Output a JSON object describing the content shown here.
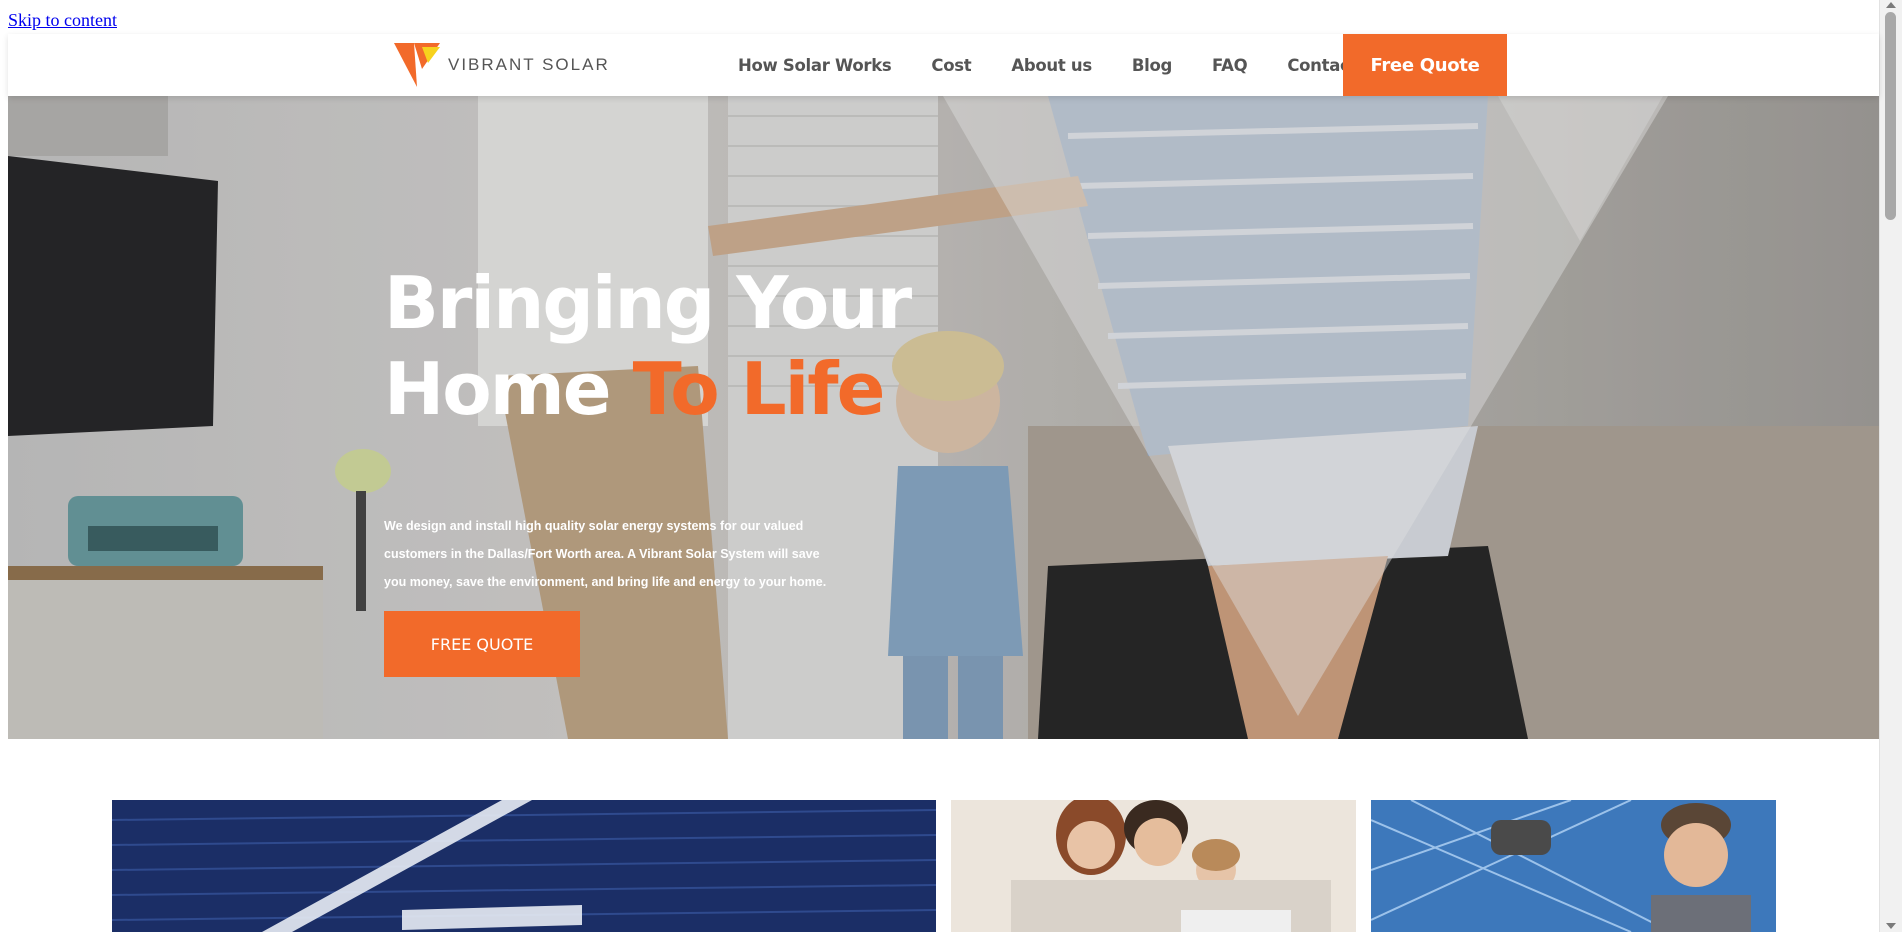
{
  "skip_link": "Skip to content",
  "brand": {
    "name": "VIBRANT SOLAR",
    "colors": {
      "accent": "#f26a2a",
      "logo_yellow": "#f7d21d",
      "text_gray": "#555555"
    }
  },
  "nav": {
    "items": [
      "How Solar Works",
      "Cost",
      "About us",
      "Blog",
      "FAQ",
      "Contact Us"
    ],
    "cta": "Free Quote"
  },
  "hero": {
    "title_line1": "Bringing Your",
    "title_line2_plain": "Home",
    "title_line2_accent": "To Life",
    "description": "We design and install high quality solar energy systems for our valued customers in the Dallas/Fort Worth area. A Vibrant Solar System will save you money, save the environment, and bring life and energy to your home.",
    "button": "FREE QUOTE"
  }
}
